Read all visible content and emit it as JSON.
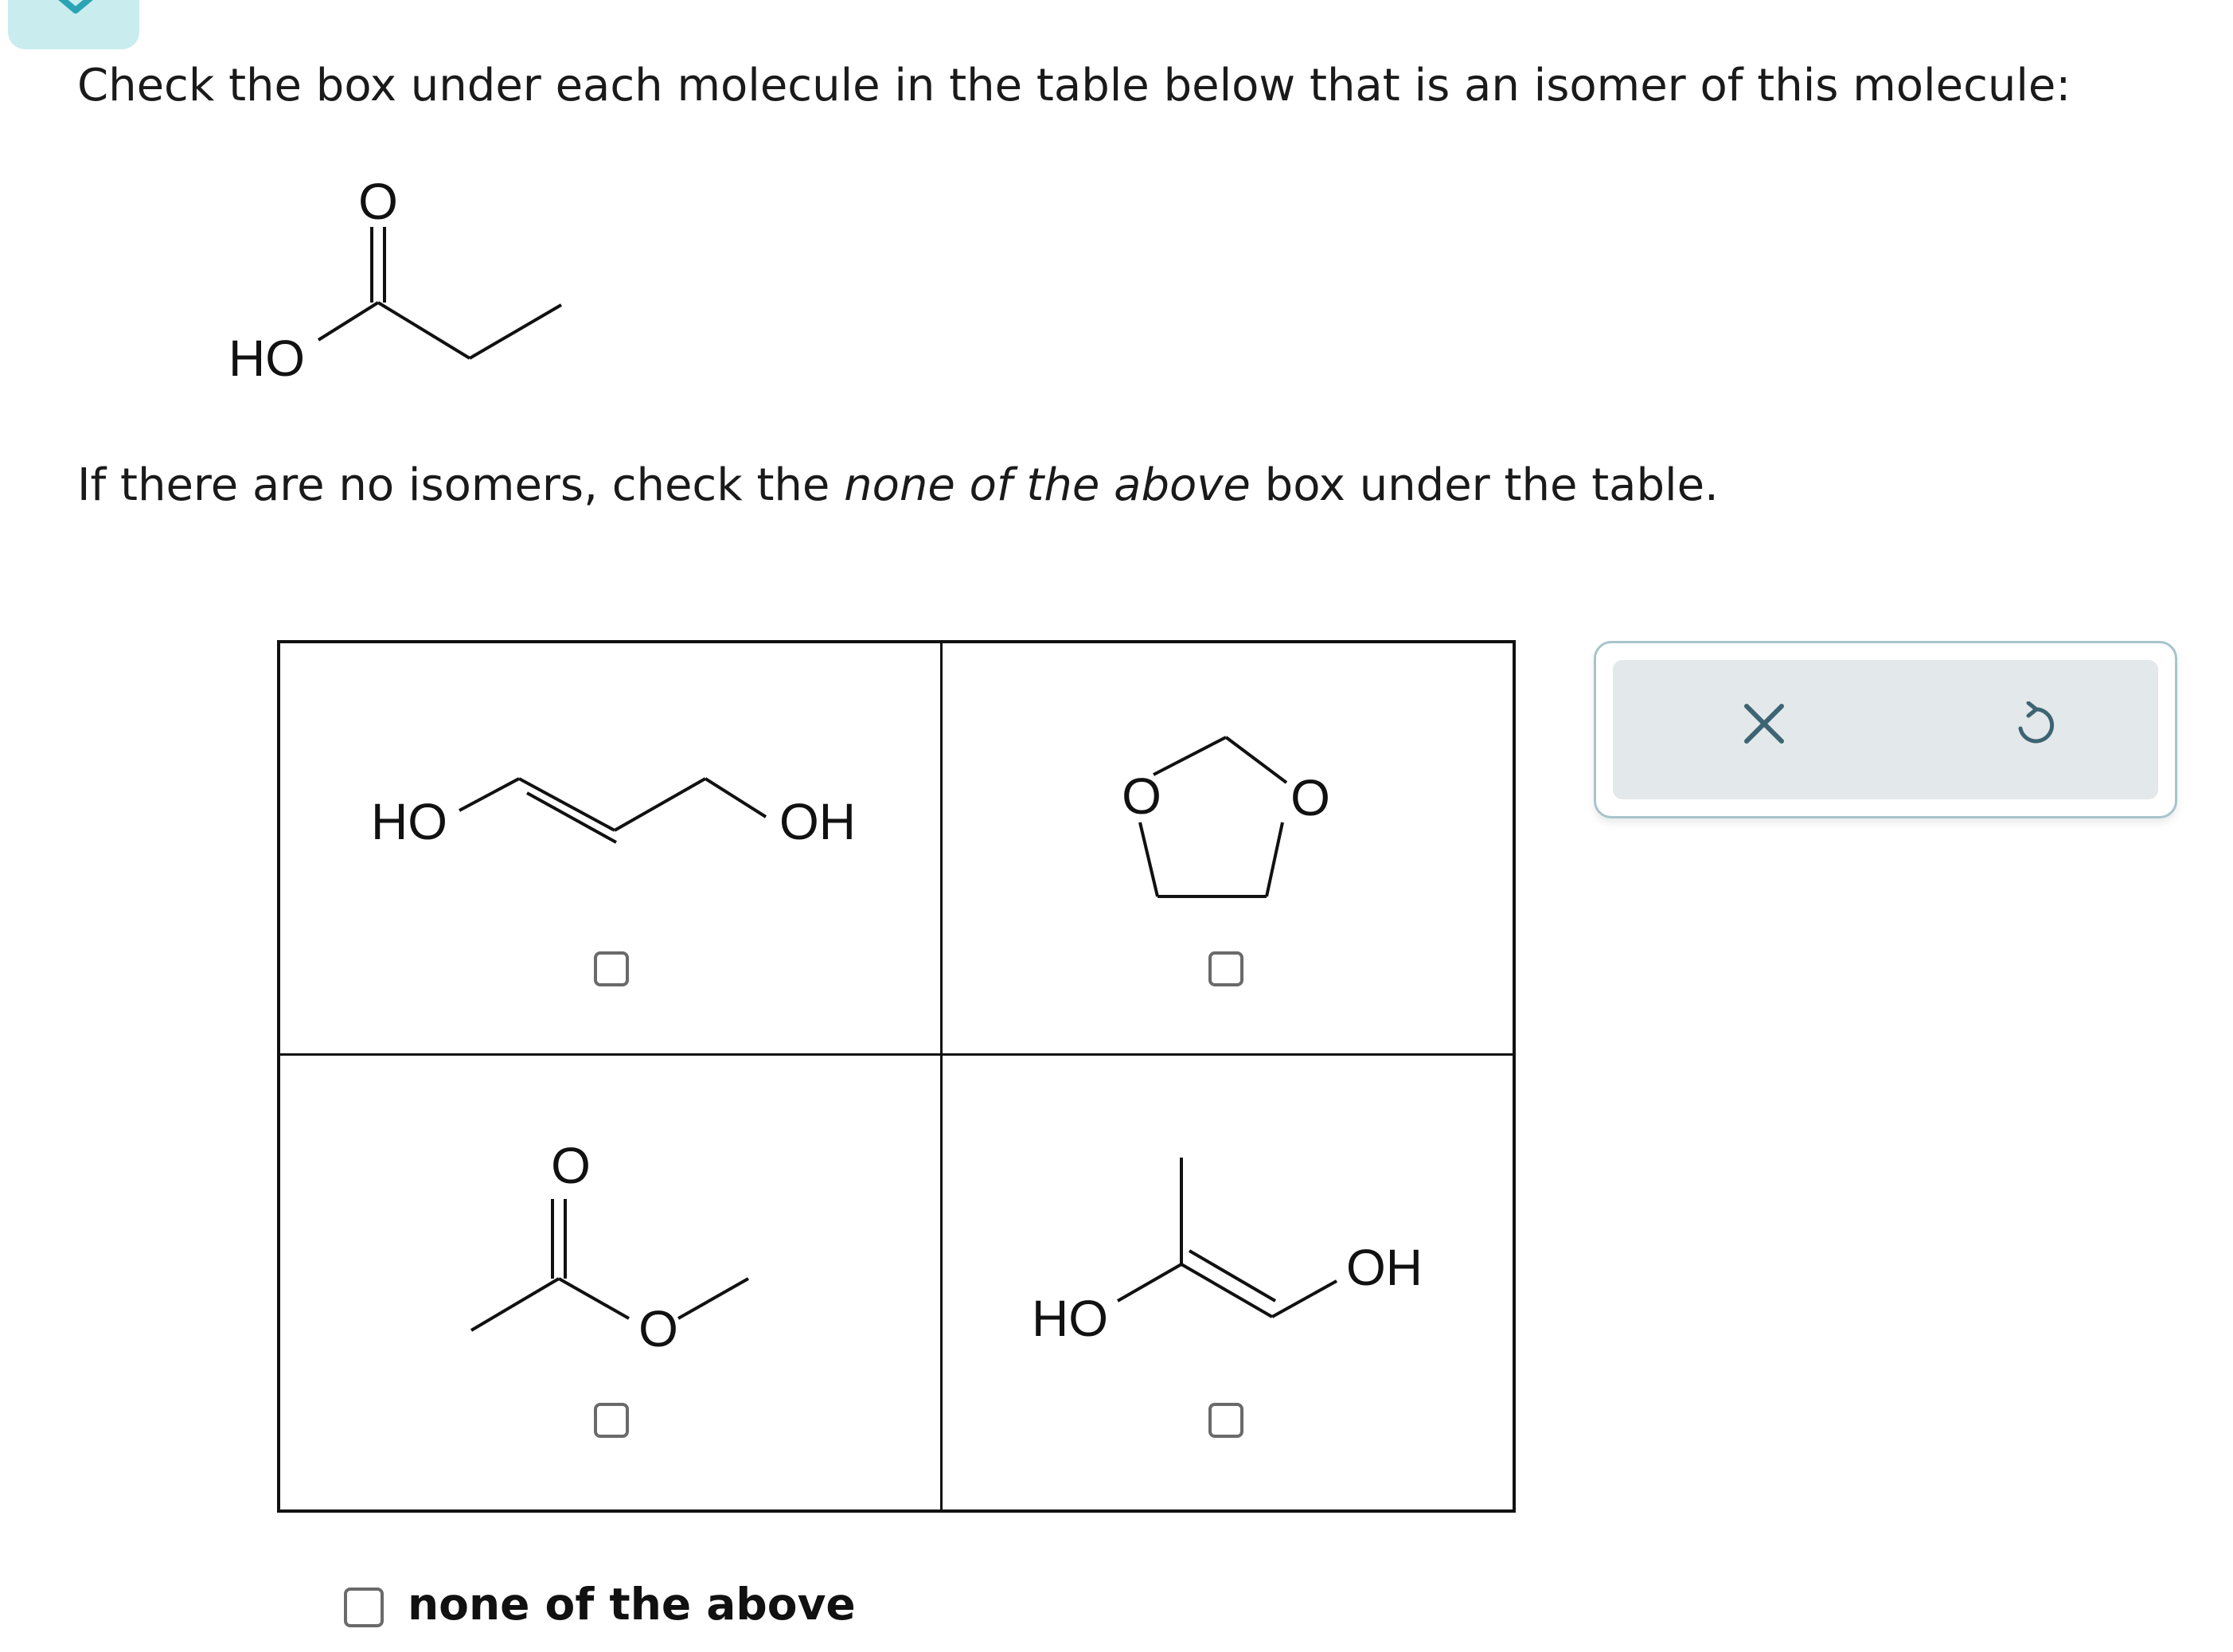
{
  "question": {
    "prompt": "Check the box under each molecule in the table below that is an isomer of this molecule:",
    "instruction_before": "If there are no isomers, check the ",
    "instruction_em": "none of the above",
    "instruction_after": " box under the table."
  },
  "target_molecule": {
    "atoms": {
      "carbonyl_o": "O",
      "hydroxyl": "HO"
    }
  },
  "options": [
    {
      "atoms": {
        "left": "HO",
        "right": "OH"
      },
      "checked": false
    },
    {
      "atoms": {
        "o1": "O",
        "o2": "O"
      },
      "checked": false
    },
    {
      "atoms": {
        "carbonyl_o": "O",
        "ether_o": "O"
      },
      "checked": false
    },
    {
      "atoms": {
        "left": "HO",
        "right": "OH"
      },
      "checked": false
    }
  ],
  "none_option": {
    "label": "none of the above",
    "checked": false
  },
  "toolbar": {
    "clear_icon": "x-icon",
    "undo_icon": "undo-icon"
  },
  "colors": {
    "accent": "#c9ecee",
    "toolbar_bg": "#e3e8ea",
    "icon": "#3d6472"
  }
}
